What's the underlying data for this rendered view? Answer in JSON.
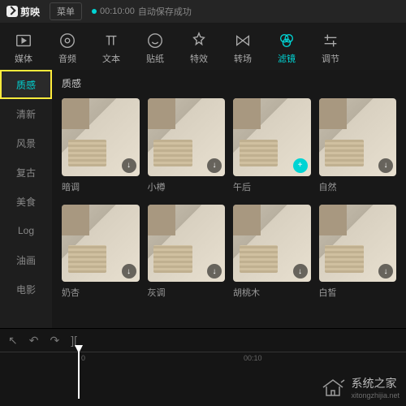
{
  "titlebar": {
    "app_name": "剪映",
    "menu_label": "菜单",
    "autosave_time": "00:10:00",
    "autosave_text": "自动保存成功"
  },
  "toolbar": [
    {
      "id": "media",
      "label": "媒体"
    },
    {
      "id": "audio",
      "label": "音频"
    },
    {
      "id": "text",
      "label": "文本"
    },
    {
      "id": "sticker",
      "label": "贴纸"
    },
    {
      "id": "effect",
      "label": "特效"
    },
    {
      "id": "transition",
      "label": "转场"
    },
    {
      "id": "filter",
      "label": "滤镜"
    },
    {
      "id": "adjust",
      "label": "调节"
    }
  ],
  "toolbar_active": "filter",
  "sidebar": {
    "items": [
      "质感",
      "清新",
      "风景",
      "复古",
      "美食",
      "Log",
      "油画",
      "电影"
    ],
    "active_index": 0
  },
  "section_title": "质感",
  "filters": [
    {
      "name": "暗调",
      "btn": "dl"
    },
    {
      "name": "小樽",
      "btn": "dl"
    },
    {
      "name": "午后",
      "btn": "add"
    },
    {
      "name": "自然",
      "btn": "dl"
    },
    {
      "name": "奶杏",
      "btn": "dl"
    },
    {
      "name": "灰调",
      "btn": "dl"
    },
    {
      "name": "胡桃木",
      "btn": "dl"
    },
    {
      "name": "白皙",
      "btn": "dl"
    }
  ],
  "timeline": {
    "ticks": [
      "0",
      "00:10"
    ]
  },
  "watermark": {
    "text": "系统之家",
    "url": "xitongzhijia.net"
  }
}
